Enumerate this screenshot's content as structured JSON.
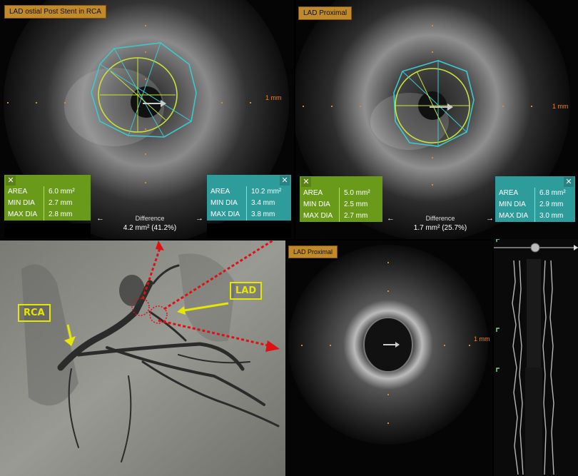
{
  "top_left": {
    "title": "LAD ostial Post Stent in RCA",
    "scale": "1 mm",
    "left_stats": {
      "area_label": "AREA",
      "area": "6.0 mm²",
      "min_label": "MIN DIA",
      "min": "2.7 mm",
      "max_label": "MAX DIA",
      "max": "2.8 mm"
    },
    "right_stats": {
      "area_label": "AREA",
      "area": "10.2 mm²",
      "min_label": "MIN DIA",
      "min": "3.4 mm",
      "max_label": "MAX DIA",
      "max": "3.8 mm"
    },
    "difference_label": "Difference",
    "difference_value": "4.2 mm²  (41.2%)"
  },
  "top_right": {
    "title": "LAD Proximal",
    "scale": "1 mm",
    "left_stats": {
      "area_label": "AREA",
      "area": "5.0 mm²",
      "min_label": "MIN DIA",
      "min": "2.5 mm",
      "max_label": "MAX DIA",
      "max": "2.7 mm"
    },
    "right_stats": {
      "area_label": "AREA",
      "area": "6.8 mm²",
      "min_label": "MIN DIA",
      "min": "2.9 mm",
      "max_label": "MAX DIA",
      "max": "3.0 mm"
    },
    "difference_label": "Difference",
    "difference_value": "1.7 mm²  (25.7%)"
  },
  "bottom_right": {
    "title": "LAD Proximal",
    "scale": "1 mm"
  },
  "angio": {
    "label_rca": "RCA",
    "label_lad": "LAD"
  },
  "symbols": {
    "close": "✕",
    "left_arrow": "←",
    "right_arrow": "→"
  },
  "colors": {
    "green": "#6a9a1a",
    "teal": "#2e9c9a",
    "tag": "#c08a2a",
    "arrow_red": "#e01010",
    "annotation_yellow": "#e6e600"
  }
}
